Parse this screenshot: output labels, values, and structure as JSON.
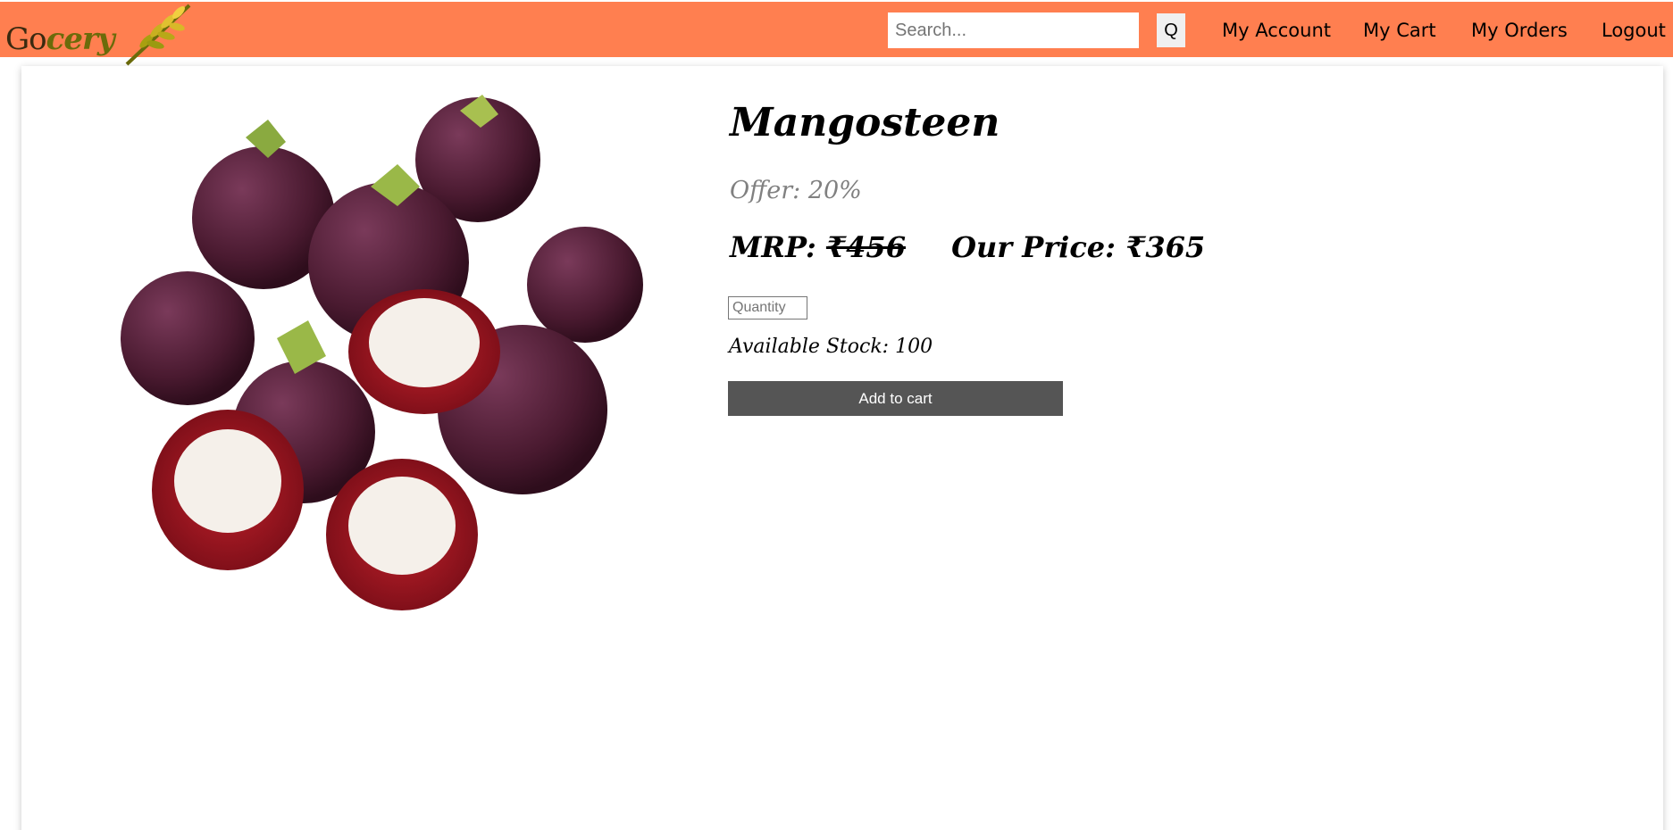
{
  "brand": {
    "logo_part1": "Go",
    "logo_part2": "cery"
  },
  "search": {
    "placeholder": "Search...",
    "button_label": "Q"
  },
  "nav": {
    "my_account": "My Account",
    "my_cart": "My Cart",
    "my_orders": "My Orders",
    "logout": "Logout"
  },
  "colors": {
    "navbar": "#ff7f50",
    "button": "#555555",
    "offer_text": "#808080"
  },
  "product": {
    "name": "Mangosteen",
    "image_icon": "mangosteen-fruit-image",
    "offer": "Offer: 20%",
    "mrp_label": "MRP:",
    "mrp_value": "₹456",
    "our_price_label": "Our Price:",
    "our_price_value": "₹365",
    "quantity_placeholder": "Quantity",
    "stock": "Available Stock: 100",
    "add_to_cart": "Add to cart"
  }
}
